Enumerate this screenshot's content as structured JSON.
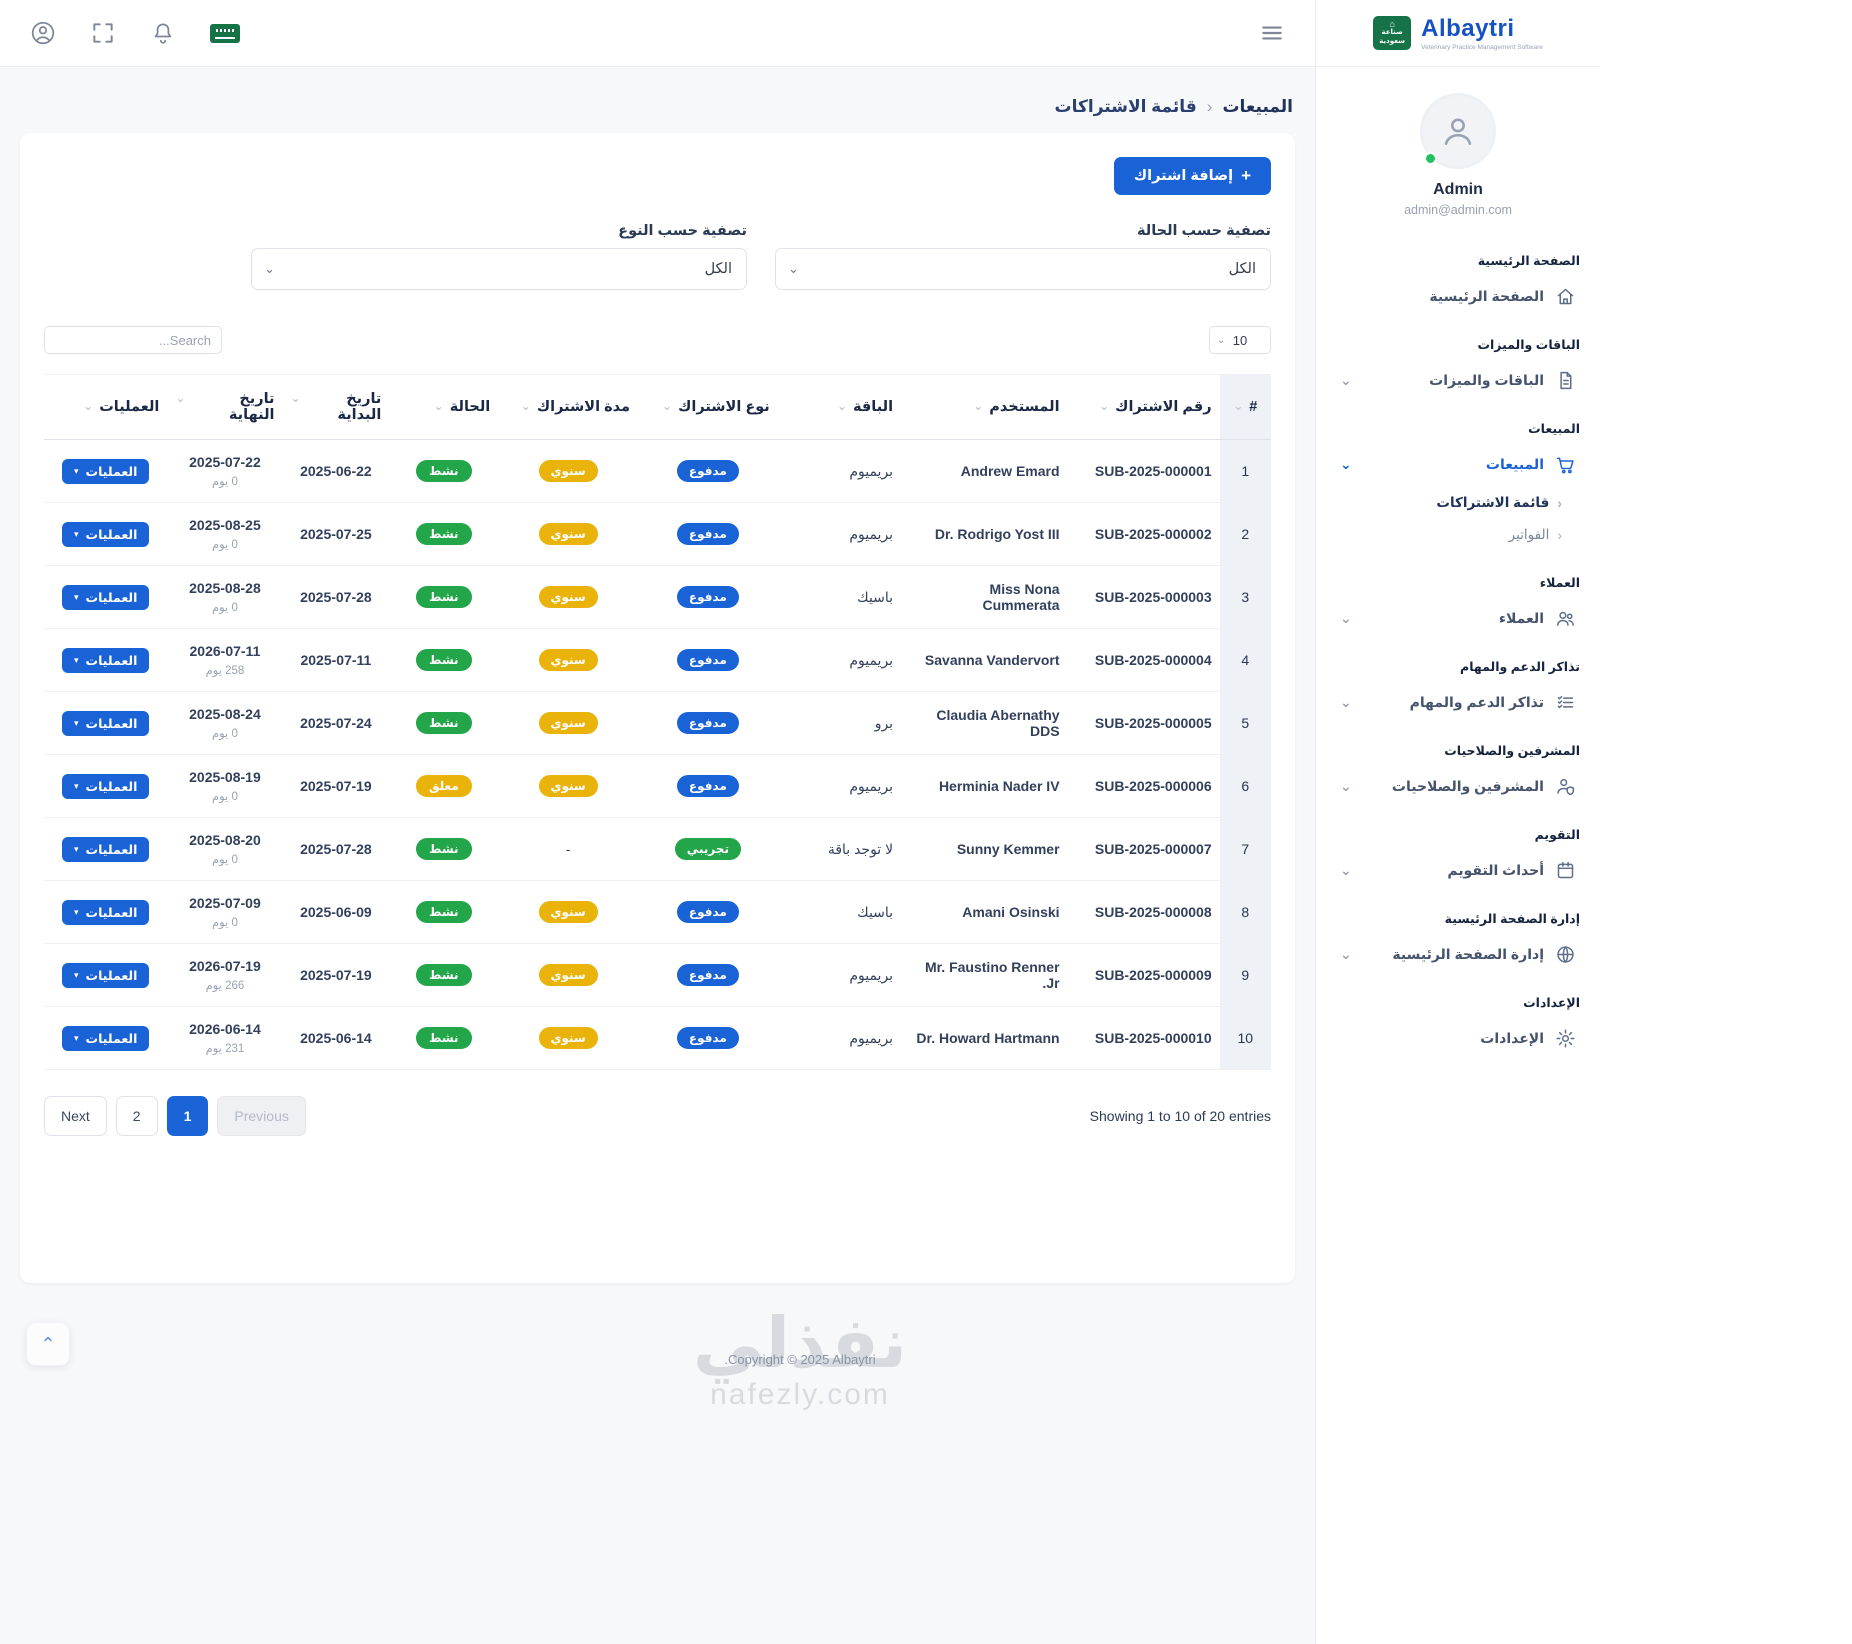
{
  "topbar": {
    "icons": [
      "user-icon",
      "fullscreen-icon",
      "bell-icon",
      "saudi-flag-icon",
      "menu-icon"
    ]
  },
  "sidebar": {
    "brand": {
      "name": "Albaytri",
      "tagline": "Veterinary Practice Management Software",
      "badge_line1": "صناعة",
      "badge_line2": "سعودية"
    },
    "user": {
      "name": "Admin",
      "email": "admin@admin.com"
    },
    "sections": [
      {
        "label": "الصفحة الرئيسية",
        "items": [
          {
            "label": "الصفحة الرئيسية",
            "icon": "home",
            "chevron": false,
            "active": false
          }
        ]
      },
      {
        "label": "الباقات والميزات",
        "items": [
          {
            "label": "الباقات والميزات",
            "icon": "document",
            "chevron": true,
            "active": false
          }
        ]
      },
      {
        "label": "المبيعات",
        "items": [
          {
            "label": "المبيعات",
            "icon": "cart",
            "chevron": true,
            "active": true,
            "children": [
              {
                "label": "قائمة الاشتراكات",
                "active": true
              },
              {
                "label": "الفواتير",
                "active": false
              }
            ]
          }
        ]
      },
      {
        "label": "العملاء",
        "items": [
          {
            "label": "العملاء",
            "icon": "users",
            "chevron": true,
            "active": false
          }
        ]
      },
      {
        "label": "تذاكر الدعم والمهام",
        "items": [
          {
            "label": "تذاكر الدعم والمهام",
            "icon": "tasks",
            "chevron": true,
            "active": false
          }
        ]
      },
      {
        "label": "المشرفين والصلاحيات",
        "items": [
          {
            "label": "المشرفين والصلاحيات",
            "icon": "admins",
            "chevron": true,
            "active": false
          }
        ]
      },
      {
        "label": "التقويم",
        "items": [
          {
            "label": "أحداث التقويم",
            "icon": "calendar",
            "chevron": true,
            "active": false
          }
        ]
      },
      {
        "label": "إدارة الصفحة الرئيسية",
        "items": [
          {
            "label": "إدارة الصفحة الرئيسية",
            "icon": "globe",
            "chevron": true,
            "active": false
          }
        ]
      },
      {
        "label": "الإعدادات",
        "items": [
          {
            "label": "الإعدادات",
            "icon": "gear",
            "chevron": false,
            "active": false
          }
        ]
      }
    ]
  },
  "breadcrumb": {
    "parent": "المبيعات",
    "current": "قائمة الاشتراكات"
  },
  "toolbar": {
    "add_button": "إضافة اشتراك"
  },
  "filters": {
    "status": {
      "label": "تصفية حسب الحالة",
      "value": "الكل"
    },
    "type": {
      "label": "تصفية حسب النوع",
      "value": "الكل"
    }
  },
  "controls": {
    "page_size": "10",
    "search_placeholder": "Search..."
  },
  "table": {
    "columns": [
      "#",
      "رقم الاشتراك",
      "المستخدم",
      "الباقة",
      "نوع الاشتراك",
      "مدة الاشتراك",
      "الحالة",
      "تاريخ البداية",
      "تاريخ النهاية",
      "العمليات"
    ],
    "actions_label": "العمليات",
    "rows": [
      {
        "num": "1",
        "sub_id": "SUB-2025-000001",
        "user": "Andrew Emard",
        "package": "بريميوم",
        "type": {
          "label": "مدفوع",
          "color": "blue"
        },
        "duration": {
          "label": "سنوي",
          "color": "yellow"
        },
        "status": {
          "label": "نشط",
          "color": "green"
        },
        "start": "2025-06-22",
        "end": "2025-07-22",
        "end_extra": "0 يوم"
      },
      {
        "num": "2",
        "sub_id": "SUB-2025-000002",
        "user": "Dr. Rodrigo Yost III",
        "package": "بريميوم",
        "type": {
          "label": "مدفوع",
          "color": "blue"
        },
        "duration": {
          "label": "سنوي",
          "color": "yellow"
        },
        "status": {
          "label": "نشط",
          "color": "green"
        },
        "start": "2025-07-25",
        "end": "2025-08-25",
        "end_extra": "0 يوم"
      },
      {
        "num": "3",
        "sub_id": "SUB-2025-000003",
        "user": "Miss Nona Cummerata",
        "package": "باسيك",
        "type": {
          "label": "مدفوع",
          "color": "blue"
        },
        "duration": {
          "label": "سنوي",
          "color": "yellow"
        },
        "status": {
          "label": "نشط",
          "color": "green"
        },
        "start": "2025-07-28",
        "end": "2025-08-28",
        "end_extra": "0 يوم"
      },
      {
        "num": "4",
        "sub_id": "SUB-2025-000004",
        "user": "Savanna Vandervort",
        "package": "بريميوم",
        "type": {
          "label": "مدفوع",
          "color": "blue"
        },
        "duration": {
          "label": "سنوي",
          "color": "yellow"
        },
        "status": {
          "label": "نشط",
          "color": "green"
        },
        "start": "2025-07-11",
        "end": "2026-07-11",
        "end_extra": "258 يوم"
      },
      {
        "num": "5",
        "sub_id": "SUB-2025-000005",
        "user": "Claudia Abernathy DDS",
        "package": "برو",
        "type": {
          "label": "مدفوع",
          "color": "blue"
        },
        "duration": {
          "label": "سنوي",
          "color": "yellow"
        },
        "status": {
          "label": "نشط",
          "color": "green"
        },
        "start": "2025-07-24",
        "end": "2025-08-24",
        "end_extra": "0 يوم"
      },
      {
        "num": "6",
        "sub_id": "SUB-2025-000006",
        "user": "Herminia Nader IV",
        "package": "بريميوم",
        "type": {
          "label": "مدفوع",
          "color": "blue"
        },
        "duration": {
          "label": "سنوي",
          "color": "yellow"
        },
        "status": {
          "label": "معلق",
          "color": "yellow"
        },
        "start": "2025-07-19",
        "end": "2025-08-19",
        "end_extra": "0 يوم"
      },
      {
        "num": "7",
        "sub_id": "SUB-2025-000007",
        "user": "Sunny Kemmer",
        "package": "لا توجد باقة",
        "type": {
          "label": "تجريبي",
          "color": "green"
        },
        "duration": null,
        "status": {
          "label": "نشط",
          "color": "green"
        },
        "start": "2025-07-28",
        "end": "2025-08-20",
        "end_extra": "0 يوم"
      },
      {
        "num": "8",
        "sub_id": "SUB-2025-000008",
        "user": "Amani Osinski",
        "package": "باسيك",
        "type": {
          "label": "مدفوع",
          "color": "blue"
        },
        "duration": {
          "label": "سنوي",
          "color": "yellow"
        },
        "status": {
          "label": "نشط",
          "color": "green"
        },
        "start": "2025-06-09",
        "end": "2025-07-09",
        "end_extra": "0 يوم"
      },
      {
        "num": "9",
        "sub_id": "SUB-2025-000009",
        "user": "Mr. Faustino Renner Jr.",
        "package": "بريميوم",
        "type": {
          "label": "مدفوع",
          "color": "blue"
        },
        "duration": {
          "label": "سنوي",
          "color": "yellow"
        },
        "status": {
          "label": "نشط",
          "color": "green"
        },
        "start": "2025-07-19",
        "end": "2026-07-19",
        "end_extra": "266 يوم"
      },
      {
        "num": "10",
        "sub_id": "SUB-2025-000010",
        "user": "Dr. Howard Hartmann",
        "package": "بريميوم",
        "type": {
          "label": "مدفوع",
          "color": "blue"
        },
        "duration": {
          "label": "سنوي",
          "color": "yellow"
        },
        "status": {
          "label": "نشط",
          "color": "green"
        },
        "start": "2025-06-14",
        "end": "2026-06-14",
        "end_extra": "231 يوم"
      }
    ]
  },
  "pagination": {
    "info": "Showing 1 to 10 of 20 entries",
    "buttons": [
      {
        "label": "Next",
        "type": "normal"
      },
      {
        "label": "2",
        "type": "normal"
      },
      {
        "label": "1",
        "type": "active"
      },
      {
        "label": "Previous",
        "type": "disabled"
      }
    ]
  },
  "footer": {
    "copyright": "Copyright © 2025 Albaytri."
  },
  "watermark": {
    "title": "نفذلي",
    "domain": "nafezly.com"
  },
  "colors": {
    "primary": "#1a63d6",
    "green": "#23a54a",
    "yellow": "#e9b30a",
    "badge_saudi": "#157347"
  }
}
